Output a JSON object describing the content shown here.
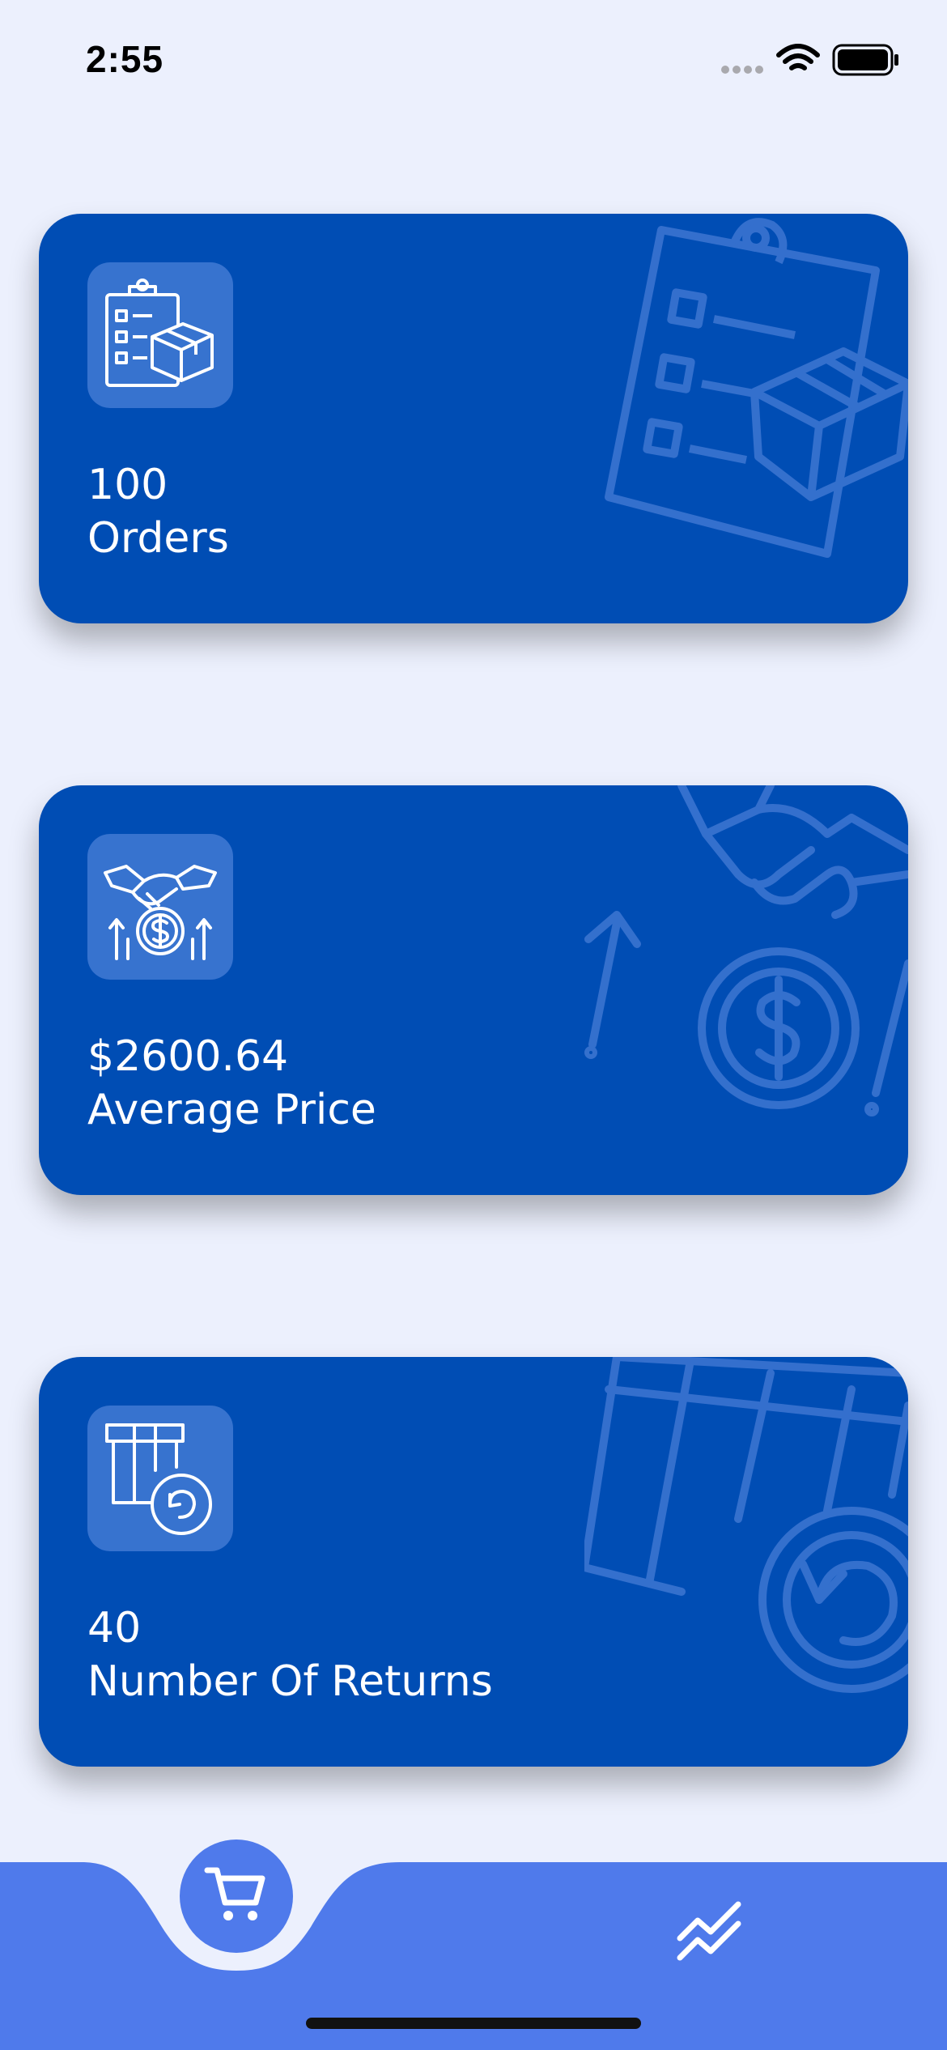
{
  "status_bar": {
    "time": "2:55",
    "icons": [
      "signal-dots-icon",
      "wifi-icon",
      "battery-icon"
    ]
  },
  "cards": [
    {
      "value": "100",
      "label": "Orders",
      "icon": "clipboard-box-icon"
    },
    {
      "value": "$2600.64",
      "label": "Average Price",
      "icon": "handshake-dollar-icon"
    },
    {
      "value": "40",
      "label": "Number Of Returns",
      "icon": "box-return-icon"
    }
  ],
  "tab_bar": {
    "items": [
      {
        "icon": "cart-icon",
        "active": true
      },
      {
        "icon": "trend-chart-icon",
        "active": false
      }
    ]
  },
  "colors": {
    "background": "#ecf0fd",
    "card": "#004db4",
    "icon_tile": "#3773cf",
    "tab_bar": "#4f7aeb"
  }
}
